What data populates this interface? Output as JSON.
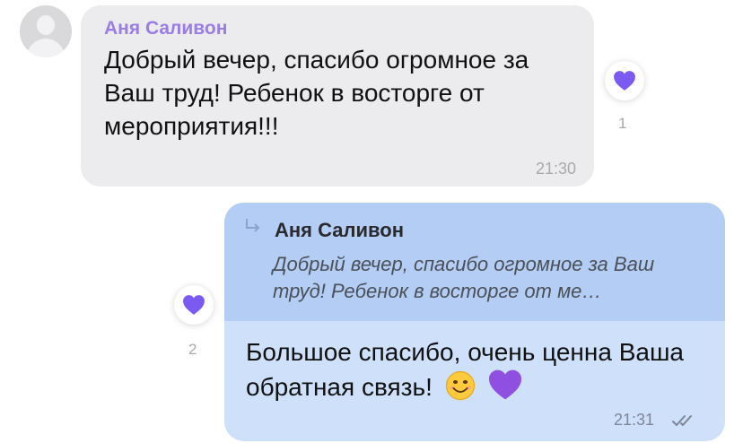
{
  "incoming_message": {
    "sender_name": "Аня Саливон",
    "text": "Добрый вечер, спасибо огромное за Ваш труд! Ребенок в восторге от мероприятия!!!",
    "time": "21:30",
    "reaction": {
      "icon": "purple-heart-icon",
      "count": "1"
    }
  },
  "outgoing_message": {
    "reply_to": {
      "sender_name": "Аня Саливон",
      "text": "Добрый вечер, спасибо огромное за Ваш труд! Ребенок в восторге от ме…"
    },
    "text": "Большое спасибо, очень ценна Ваша обратная связь!",
    "emojis": [
      "smiling-face-icon",
      "purple-heart-icon"
    ],
    "time": "21:31",
    "status_icon": "double-check-icon",
    "reaction": {
      "icon": "purple-heart-icon",
      "count": "2"
    }
  },
  "colors": {
    "sender_name": "#9b7ce6",
    "incoming_bubble": "#ececee",
    "outgoing_bubble": "#cfe0fb",
    "quote_background": "#b3cdf4",
    "heart": "#7a5af0"
  }
}
